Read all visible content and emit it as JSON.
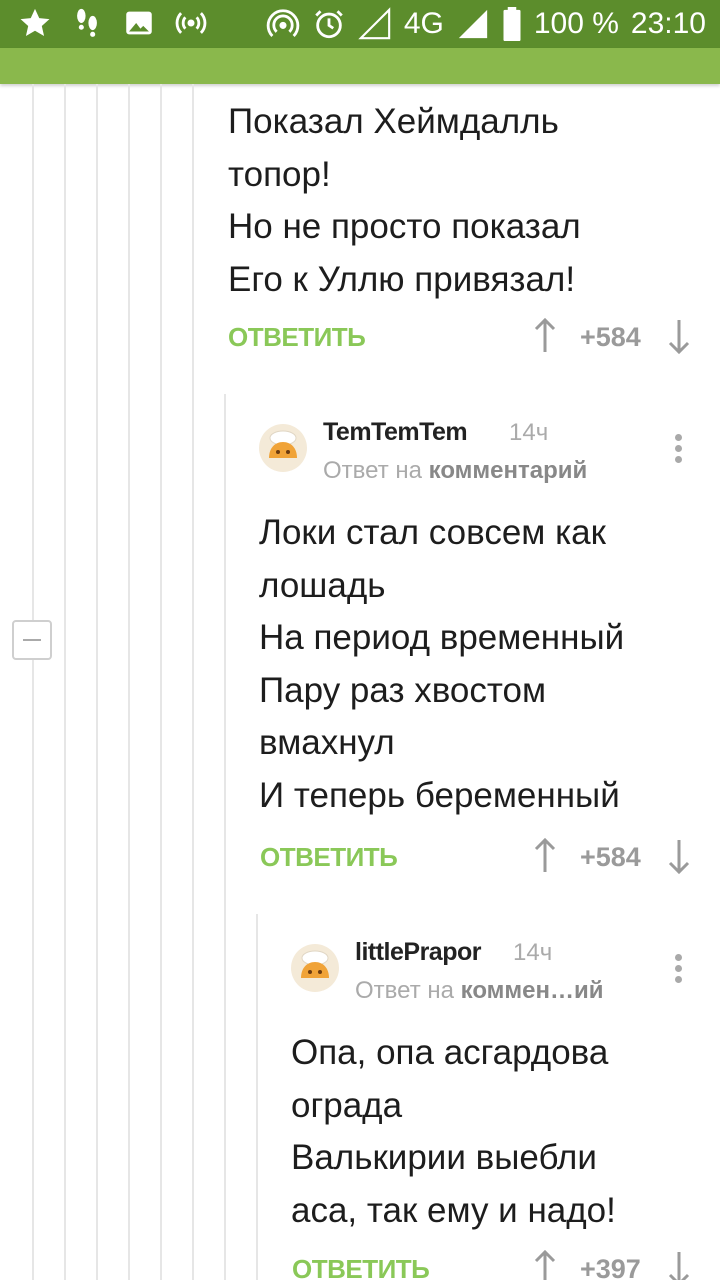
{
  "status_bar": {
    "icons_left": [
      "star-icon",
      "footprints-icon",
      "image-icon",
      "radio-waves-icon"
    ],
    "icons_right": [
      "hotspot-icon",
      "alarm-icon",
      "signal-empty-icon"
    ],
    "network": "4G",
    "network_small": "4G",
    "battery": "100 %",
    "time": "23:10"
  },
  "colors": {
    "status_bar": "#5c8d2c",
    "app_bar": "#8ab84c",
    "reply_green": "#8ac858",
    "muted": "#9a9a9a"
  },
  "comments": [
    {
      "lines": [
        "Показал Хеймдалль",
        "топор!",
        "Но не просто показал",
        "Его к Уллю привязал!"
      ],
      "reply_label": "ОТВЕТИТЬ",
      "score": "+584"
    },
    {
      "author": "TemTemTem",
      "time": "14ч",
      "reply_prefix": "Ответ на",
      "reply_target": "комментарий",
      "lines": [
        "Локи стал совсем как",
        "лошадь",
        "На период временный",
        "Пару раз хвостом",
        "вмахнул",
        "И теперь беременный"
      ],
      "reply_label": "ОТВЕТИТЬ",
      "score": "+584"
    },
    {
      "author": "littlePrapor",
      "time": "14ч",
      "reply_prefix": "Ответ на",
      "reply_target": "коммен…ий",
      "lines": [
        "Опа, опа асгардова",
        "ограда",
        "Валькирии выебли",
        "аса, так ему и надо!"
      ],
      "reply_label": "ОТВЕТИТЬ",
      "score": "+397"
    }
  ]
}
